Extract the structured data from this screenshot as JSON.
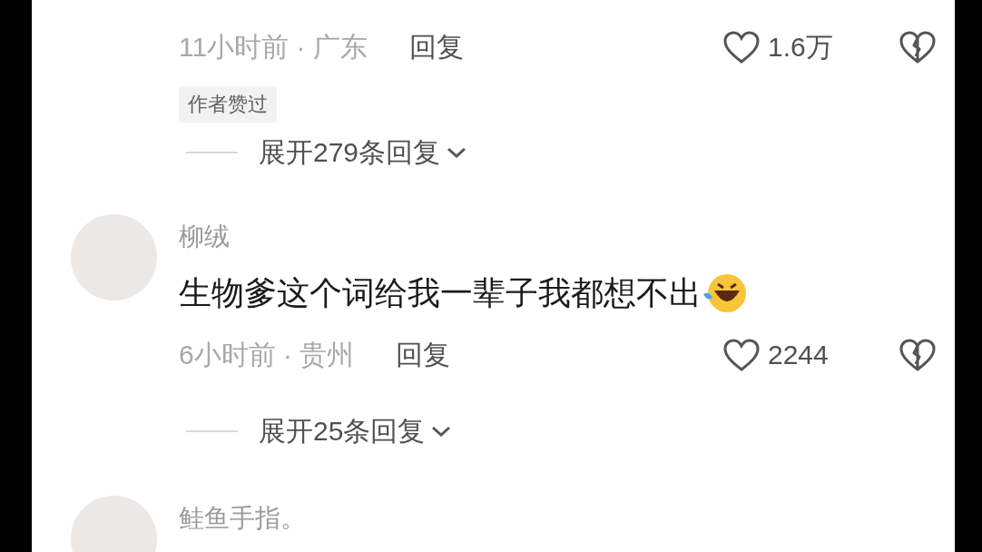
{
  "comments": [
    {
      "meta": "11小时前 · 广东",
      "reply": "回复",
      "likes": "1.6万",
      "tag": "作者赞过",
      "expand": "展开279条回复"
    },
    {
      "username": "柳绒",
      "text": "生物爹这个词给我一辈子我都想不出",
      "meta": "6小时前 · 贵州",
      "reply": "回复",
      "likes": "2244",
      "expand": "展开25条回复"
    },
    {
      "username": "鲑鱼手指。"
    }
  ]
}
